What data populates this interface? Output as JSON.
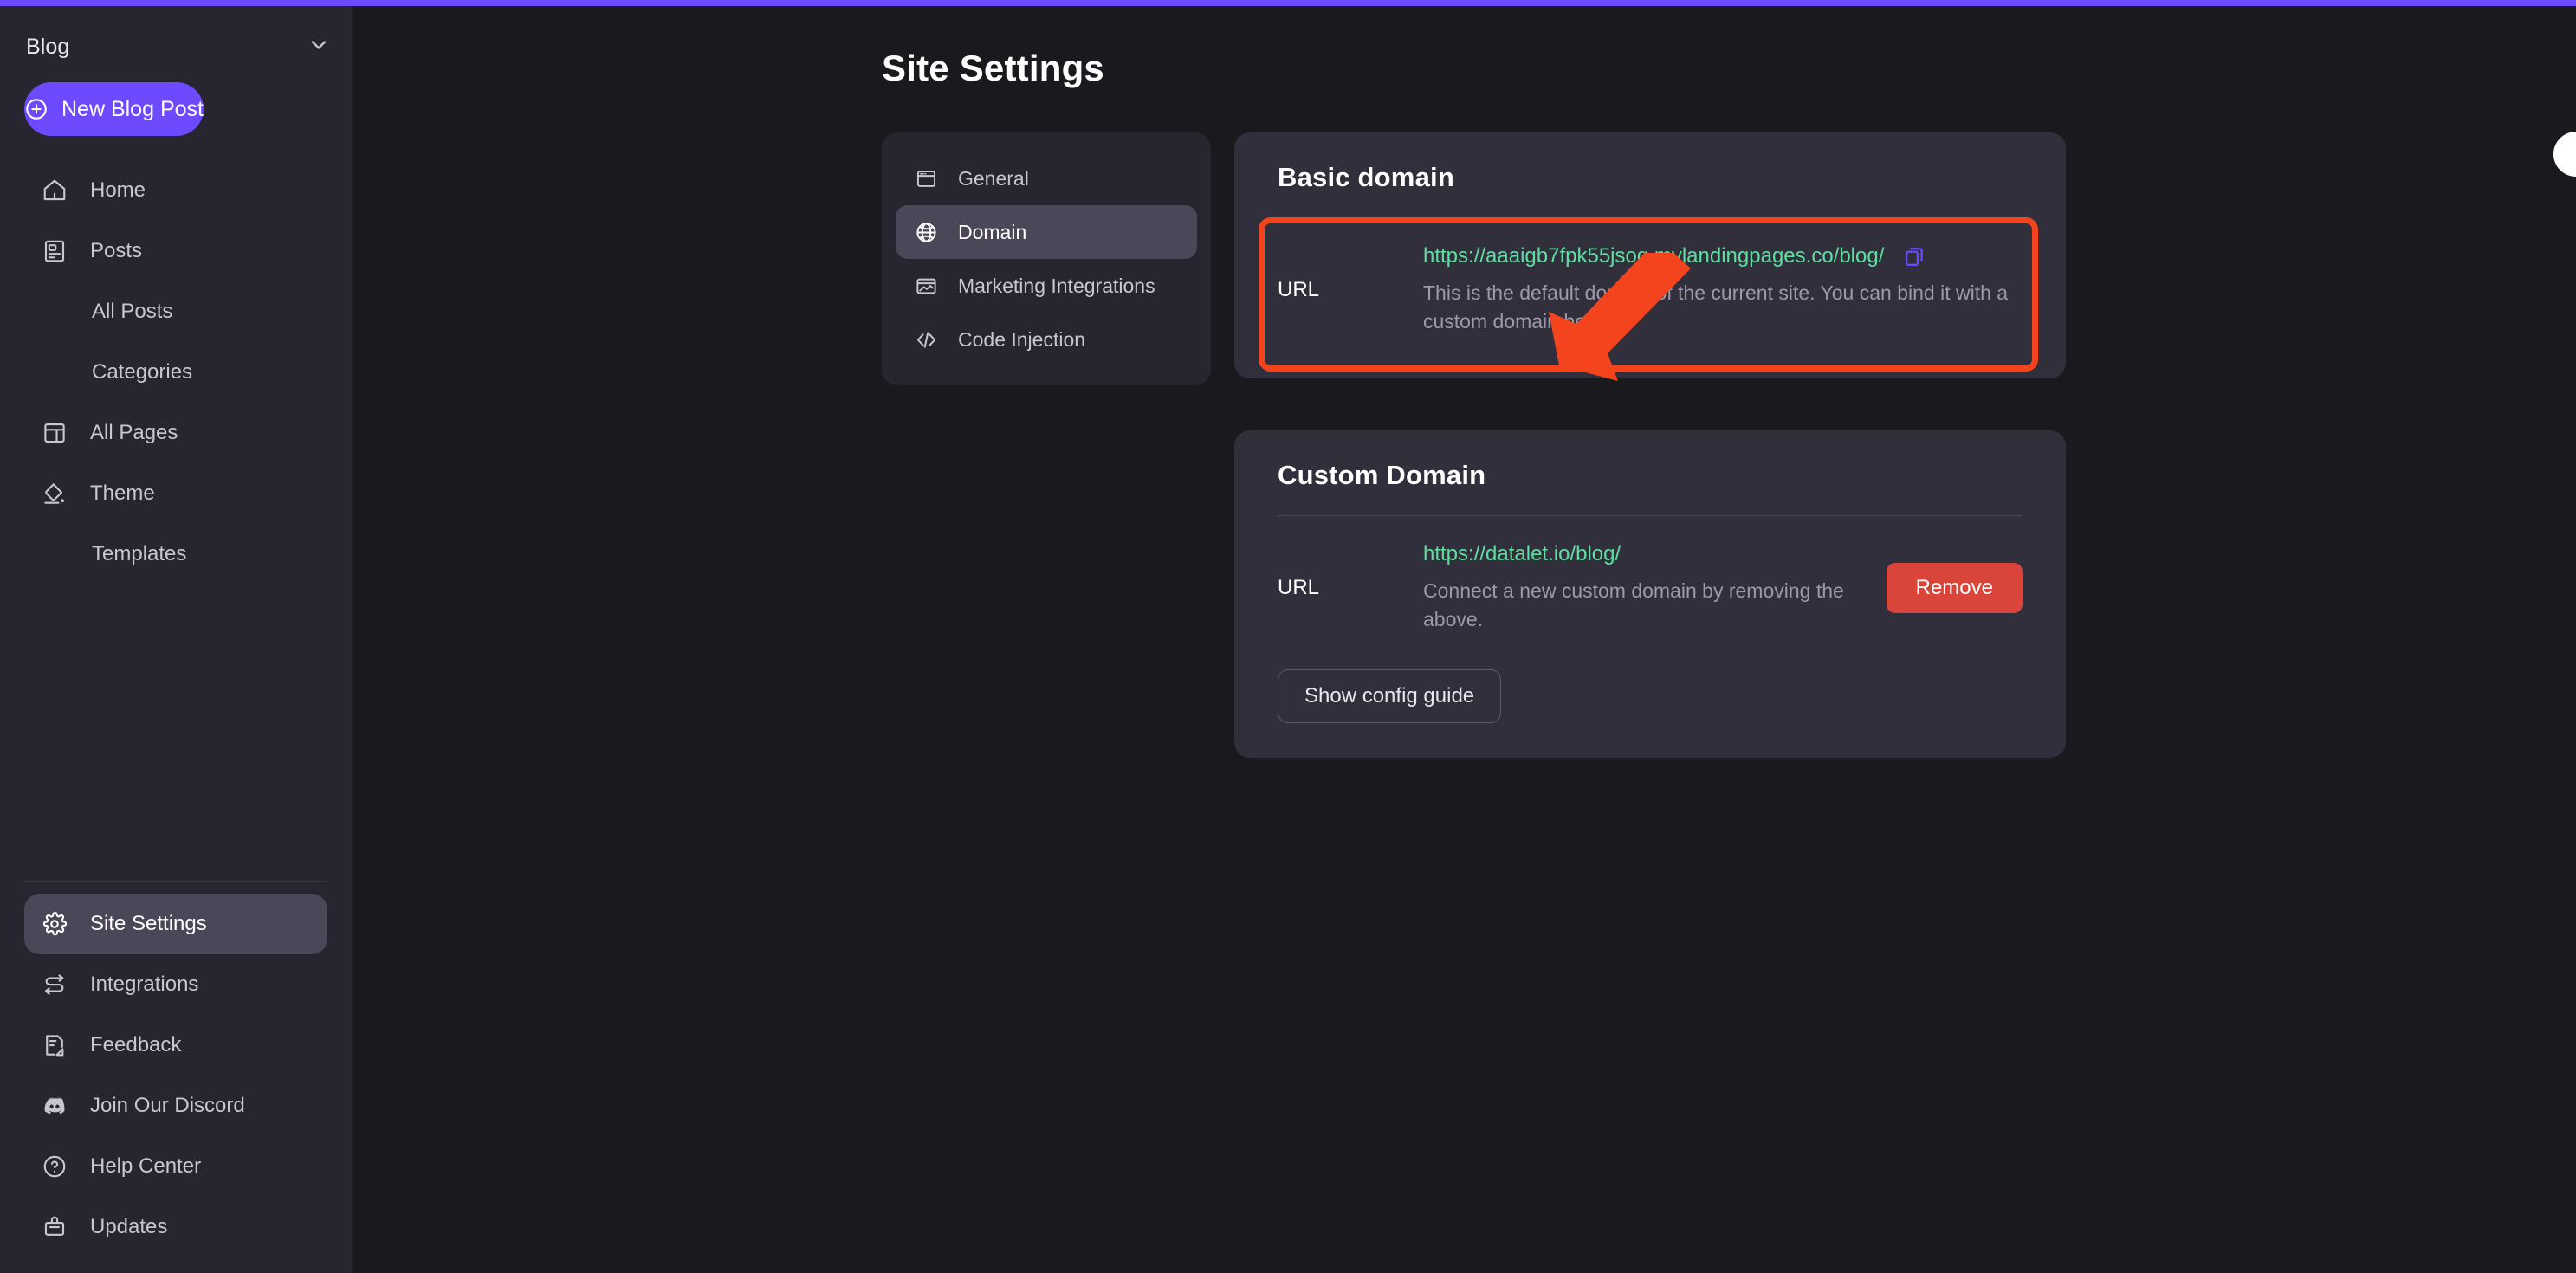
{
  "theme": {
    "accent": "#6d4aff",
    "sidebar_bg": "#272630",
    "main_bg": "#1a191e",
    "card_bg": "#322f3c",
    "active_bg": "#4b4758",
    "link_green": "#5ddfa0",
    "danger_red": "#d9453a",
    "annotation_red": "#f4441e"
  },
  "sidebar": {
    "site_switcher": {
      "label": "Blog",
      "icon": "chevron-down-icon"
    },
    "new_post_button": {
      "label": "New Blog Post",
      "icon": "plus-circle-icon"
    },
    "items": [
      {
        "label": "Home",
        "icon": "home-icon",
        "sub": false,
        "active": false
      },
      {
        "label": "Posts",
        "icon": "posts-icon",
        "sub": false,
        "active": false
      },
      {
        "label": "All Posts",
        "icon": "",
        "sub": true,
        "active": false
      },
      {
        "label": "Categories",
        "icon": "",
        "sub": true,
        "active": false
      },
      {
        "label": "All Pages",
        "icon": "pages-icon",
        "sub": false,
        "active": false
      },
      {
        "label": "Theme",
        "icon": "paint-bucket-icon",
        "sub": false,
        "active": false
      },
      {
        "label": "Templates",
        "icon": "",
        "sub": true,
        "active": false
      }
    ],
    "bottom_items": [
      {
        "label": "Site Settings",
        "icon": "gear-icon",
        "active": true
      },
      {
        "label": "Integrations",
        "icon": "integrations-icon",
        "active": false
      },
      {
        "label": "Feedback",
        "icon": "feedback-icon",
        "active": false
      },
      {
        "label": "Join Our Discord",
        "icon": "discord-icon",
        "active": false
      },
      {
        "label": "Help Center",
        "icon": "question-circle-icon",
        "active": false
      },
      {
        "label": "Updates",
        "icon": "updates-icon",
        "active": false
      }
    ]
  },
  "main": {
    "page_title": "Site Settings",
    "settings_tabs": [
      {
        "label": "General",
        "icon": "window-icon",
        "active": false
      },
      {
        "label": "Domain",
        "icon": "globe-icon",
        "active": true
      },
      {
        "label": "Marketing Integrations",
        "icon": "marketing-icon",
        "active": false
      },
      {
        "label": "Code Injection",
        "icon": "code-icon",
        "active": false
      }
    ],
    "basic_domain": {
      "title": "Basic domain",
      "url_label": "URL",
      "url": "https://aaaigb7fpk55jsoq.mylandingpages.co/blog/",
      "copy_icon": "copy-icon",
      "description": "This is the default domain of the current site. You can bind it with a custom domain below."
    },
    "custom_domain": {
      "title": "Custom Domain",
      "url_label": "URL",
      "url": "https://datalet.io/blog/",
      "description": "Connect a new custom domain by removing the above.",
      "remove_label": "Remove",
      "show_config_label": "Show config guide"
    }
  }
}
